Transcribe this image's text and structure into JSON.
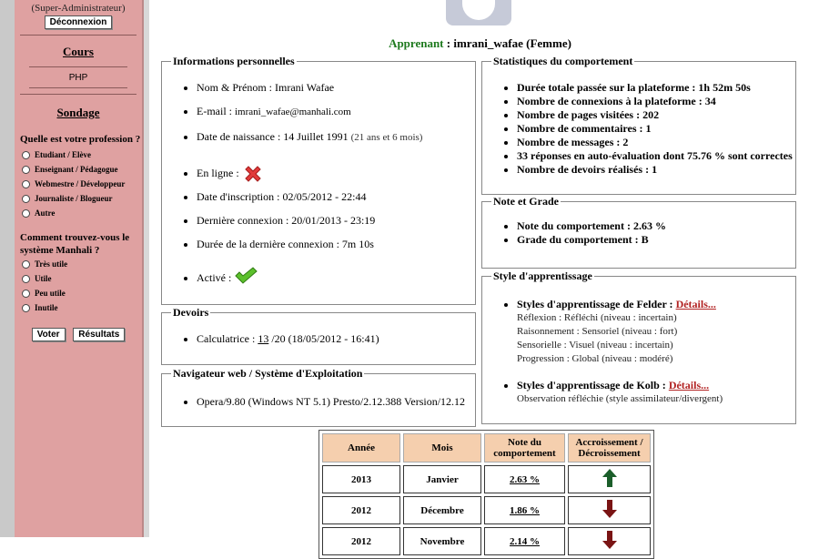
{
  "sidebar": {
    "role": "(Super-Administrateur)",
    "logout_label": "Déconnexion",
    "courses_title": "Cours",
    "course_item": "PHP",
    "survey_title": "Sondage",
    "q1": "Quelle est votre profession ?",
    "q1_options": [
      "Etudiant / Elève",
      "Enseignant / Pédagogue",
      "Webmestre / Développeur",
      "Journaliste / Blogueur",
      "Autre"
    ],
    "q2": "Comment trouvez-vous le système Manhali ?",
    "q2_options": [
      "Très utile",
      "Utile",
      "Peu utile",
      "Inutile"
    ],
    "vote_label": "Voter",
    "results_label": "Résultats"
  },
  "learner": {
    "label": "Apprenant",
    "name": " : imrani_wafae (Femme)"
  },
  "personal": {
    "legend": "Informations personnelles",
    "name_label": "Nom & Prénom : ",
    "name_value": "Imrani Wafae",
    "email_label": "E-mail : ",
    "email_value": "imrani_wafae@manhali.com",
    "birth_label": "Date de naissance : 14 Juillet 1991 ",
    "birth_age": "(21 ans et 6 mois)",
    "online_label": "En ligne : ",
    "signup_label": "Date d'inscription : 02/05/2012 - 22:44",
    "last_label": "Dernière connexion : 20/01/2013 - 23:19",
    "duration_label": "Durée de la dernière connexion : 7m 10s",
    "active_label": "Activé : "
  },
  "homework": {
    "legend": "Devoirs",
    "item_prefix": "Calculatrice : ",
    "item_grade": "13",
    "item_suffix": " /20 (18/05/2012 - 16:41)"
  },
  "browser": {
    "legend": "Navigateur web / Système d'Exploitation",
    "value": "Opera/9.80 (Windows NT 5.1) Presto/2.12.388 Version/12.12"
  },
  "stats": {
    "legend": "Statistiques du comportement",
    "items": [
      "Durée totale passée sur la plateforme : 1h 52m 50s",
      "Nombre de connexions à la plateforme : 34",
      "Nombre de pages visitées : 202",
      "Nombre de commentaires : 1",
      "Nombre de messages : 2",
      "33 réponses en auto-évaluation dont 75.76 % sont correctes",
      "Nombre de devoirs réalisés : 1"
    ]
  },
  "grade": {
    "legend": "Note et Grade",
    "note": "Note du comportement : 2.63 %",
    "grade": "Grade du comportement : B"
  },
  "learning": {
    "legend": "Style d'apprentissage",
    "felder_label": "Styles d'apprentissage de Felder : ",
    "details_label": "Détails...",
    "felder_lines": [
      "Réflexion : Réfléchi (niveau : incertain)",
      "Raisonnement : Sensoriel (niveau : fort)",
      "Sensorielle : Visuel (niveau : incertain)",
      "Progression : Global (niveau : modéré)"
    ],
    "kolb_label": "Styles d'apprentissage de Kolb : ",
    "kolb_line": "Observation réfléchie (style assimilateur/divergent)"
  },
  "table": {
    "headers": [
      "Année",
      "Mois",
      "Note du comportement",
      "Accroissement / Décroissement"
    ],
    "rows": [
      {
        "year": "2013",
        "month": "Janvier",
        "note": "2.63 %",
        "trend": "up"
      },
      {
        "year": "2012",
        "month": "Décembre",
        "note": "1.86 %",
        "trend": "down"
      },
      {
        "year": "2012",
        "month": "Novembre",
        "note": "2.14 %",
        "trend": "down"
      }
    ]
  },
  "colors": {
    "sidebar": "#dfa1a1",
    "learner_label": "#1e7a1e",
    "link": "#b22222",
    "up_arrow": "#1b5e2a",
    "down_arrow": "#7a1414",
    "header_bg": "#f5cfae"
  }
}
